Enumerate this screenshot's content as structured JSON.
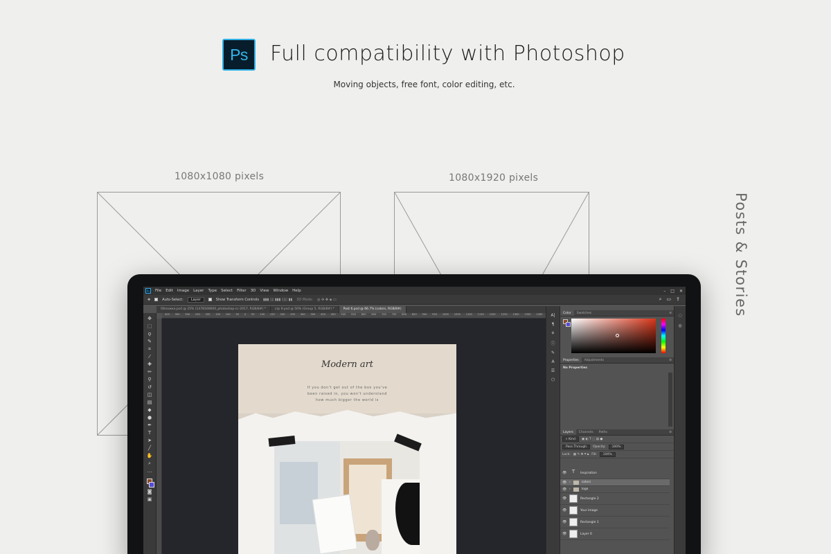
{
  "header": {
    "logo_text": "Ps",
    "headline": "Full compatibility with Photoshop",
    "subhead": "Moving objects, free font, color editing, etc."
  },
  "placeholders": [
    {
      "label": "1080x1080 pixels"
    },
    {
      "label": "1080x1920 pixels"
    }
  ],
  "side_label": "Posts & Stories",
  "photoshop": {
    "menu": [
      "File",
      "Edit",
      "Image",
      "Layer",
      "Type",
      "Select",
      "Filter",
      "3D",
      "View",
      "Window",
      "Help"
    ],
    "options": {
      "auto_select": "Auto-Select:",
      "auto_select_target": "Layer",
      "show_transform": "Show Transform Controls",
      "mode_3d": "3D Mode:"
    },
    "tabs": [
      {
        "label": "Обложка.psd @ 25% (1478160600_photoshop-cc-2017, RGB/8#) *",
        "active": false
      },
      {
        "label": "crp 9.psd @ 50% (Group 5, RGB/8#) *",
        "active": false
      },
      {
        "label": "Post 6.psd @ 66.7% (colors, RGB/8#)",
        "active": true
      }
    ],
    "ruler_ticks": [
      "400",
      "350",
      "300",
      "250",
      "200",
      "150",
      "100",
      "50",
      "0",
      "50",
      "100",
      "150",
      "200",
      "250",
      "300",
      "350",
      "400",
      "450",
      "500",
      "550",
      "600",
      "650",
      "700",
      "750",
      "800",
      "850",
      "900",
      "950",
      "1000",
      "1050",
      "1100",
      "1150",
      "1200",
      "1250",
      "1300",
      "1350",
      "1400"
    ],
    "document": {
      "title": "Modern art",
      "body_lines": [
        "If you don't get out of the box you've",
        "been raised in, you won't understand",
        "how much bigger the world is"
      ]
    },
    "color_panel": {
      "tabs": [
        "Color",
        "Swatches"
      ],
      "foreground": "#8b4a2b",
      "background": "#5a49d6"
    },
    "properties_panel": {
      "tabs": [
        "Properties",
        "Adjustments"
      ],
      "body": "No Properties"
    },
    "layers_panel": {
      "tabs": [
        "Layers",
        "Channels",
        "Paths"
      ],
      "filter": "Kind",
      "blend_mode": "Pass Through",
      "opacity_label": "Opacity:",
      "opacity_value": "100%",
      "lock_label": "Lock:",
      "fill_label": "Fill:",
      "fill_value": "100%",
      "layers": [
        {
          "name": "Inspiration",
          "kind": "text",
          "selected": false
        },
        {
          "name": "colors",
          "kind": "folder",
          "selected": true
        },
        {
          "name": "logo",
          "kind": "folder",
          "selected": false
        },
        {
          "name": "Rectangle 2",
          "kind": "image",
          "selected": false
        },
        {
          "name": "Your image",
          "kind": "image",
          "selected": false
        },
        {
          "name": "Rectangle 1",
          "kind": "image",
          "selected": false
        },
        {
          "name": "Layer 0",
          "kind": "image",
          "selected": false
        }
      ]
    }
  }
}
